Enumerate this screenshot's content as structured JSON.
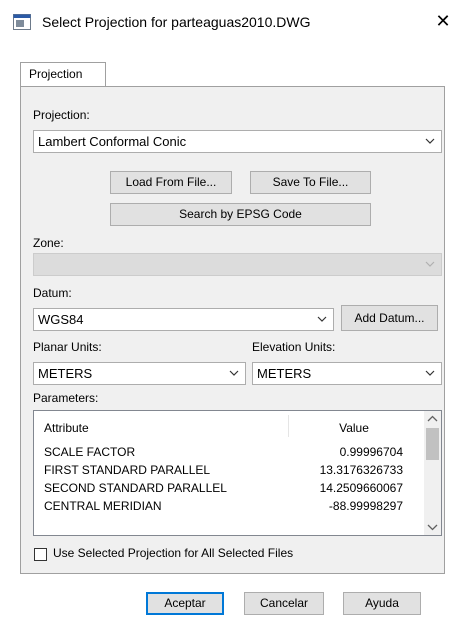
{
  "window": {
    "title": "Select Projection for parteaguas2010.DWG",
    "close_glyph": "✕"
  },
  "tab": {
    "label": "Projection"
  },
  "projection": {
    "label": "Projection:",
    "value": "Lambert Conformal Conic",
    "load_button": "Load From File...",
    "save_button": "Save To File...",
    "epsg_button": "Search by EPSG Code"
  },
  "zone": {
    "label": "Zone:",
    "value": ""
  },
  "datum": {
    "label": "Datum:",
    "value": "WGS84",
    "add_button": "Add Datum..."
  },
  "units": {
    "planar_label": "Planar Units:",
    "planar_value": "METERS",
    "elevation_label": "Elevation Units:",
    "elevation_value": "METERS"
  },
  "parameters": {
    "label": "Parameters:",
    "columns": {
      "attribute": "Attribute",
      "value": "Value"
    },
    "rows": [
      {
        "attribute": "SCALE FACTOR",
        "value": "0.99996704"
      },
      {
        "attribute": "FIRST STANDARD PARALLEL",
        "value": "13.3176326733"
      },
      {
        "attribute": "SECOND STANDARD PARALLEL",
        "value": "14.2509660067"
      },
      {
        "attribute": "CENTRAL MERIDIAN",
        "value": "-88.99998297"
      }
    ]
  },
  "apply_all": {
    "label": "Use Selected Projection for All Selected Files",
    "checked": false
  },
  "footer": {
    "ok": "Aceptar",
    "cancel": "Cancelar",
    "help": "Ayuda"
  },
  "colors": {
    "default_button_border": "#0078d7",
    "panel_background": "#f0f0f0"
  },
  "icons": [
    "app-icon",
    "close-icon",
    "chevron-down-icon",
    "scroll-up-icon",
    "scroll-down-icon"
  ]
}
